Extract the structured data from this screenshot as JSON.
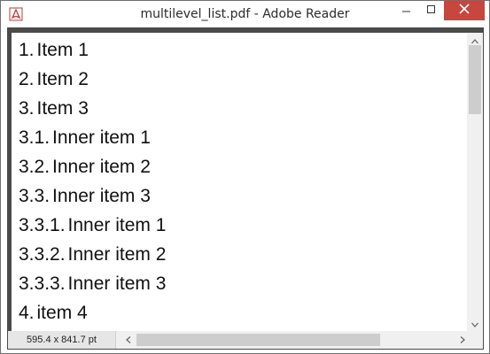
{
  "window": {
    "title": "multilevel_list.pdf - Adobe Reader",
    "close_color": "#c7463d"
  },
  "icons": {
    "app": "adobe-reader-icon",
    "minimize": "minimize-icon",
    "maximize": "maximize-icon",
    "close": "close-icon",
    "scroll_up": "chevron-up-icon",
    "scroll_down": "chevron-down-icon",
    "scroll_left": "chevron-left-icon",
    "scroll_right": "chevron-right-icon"
  },
  "list": [
    {
      "num": "1.",
      "text": "Item 1"
    },
    {
      "num": "2.",
      "text": "Item 2"
    },
    {
      "num": "3.",
      "text": "Item 3"
    },
    {
      "num": "3.1.",
      "text": "Inner item 1"
    },
    {
      "num": "3.2.",
      "text": "Inner item 2"
    },
    {
      "num": "3.3.",
      "text": "Inner item 3"
    },
    {
      "num": "3.3.1.",
      "text": "Inner item 1"
    },
    {
      "num": "3.3.2.",
      "text": "Inner item 2"
    },
    {
      "num": "3.3.3.",
      "text": "Inner item 3"
    },
    {
      "num": "4.",
      "text": "item 4"
    }
  ],
  "status": {
    "page_size": "595.4 x 841.7 pt"
  }
}
